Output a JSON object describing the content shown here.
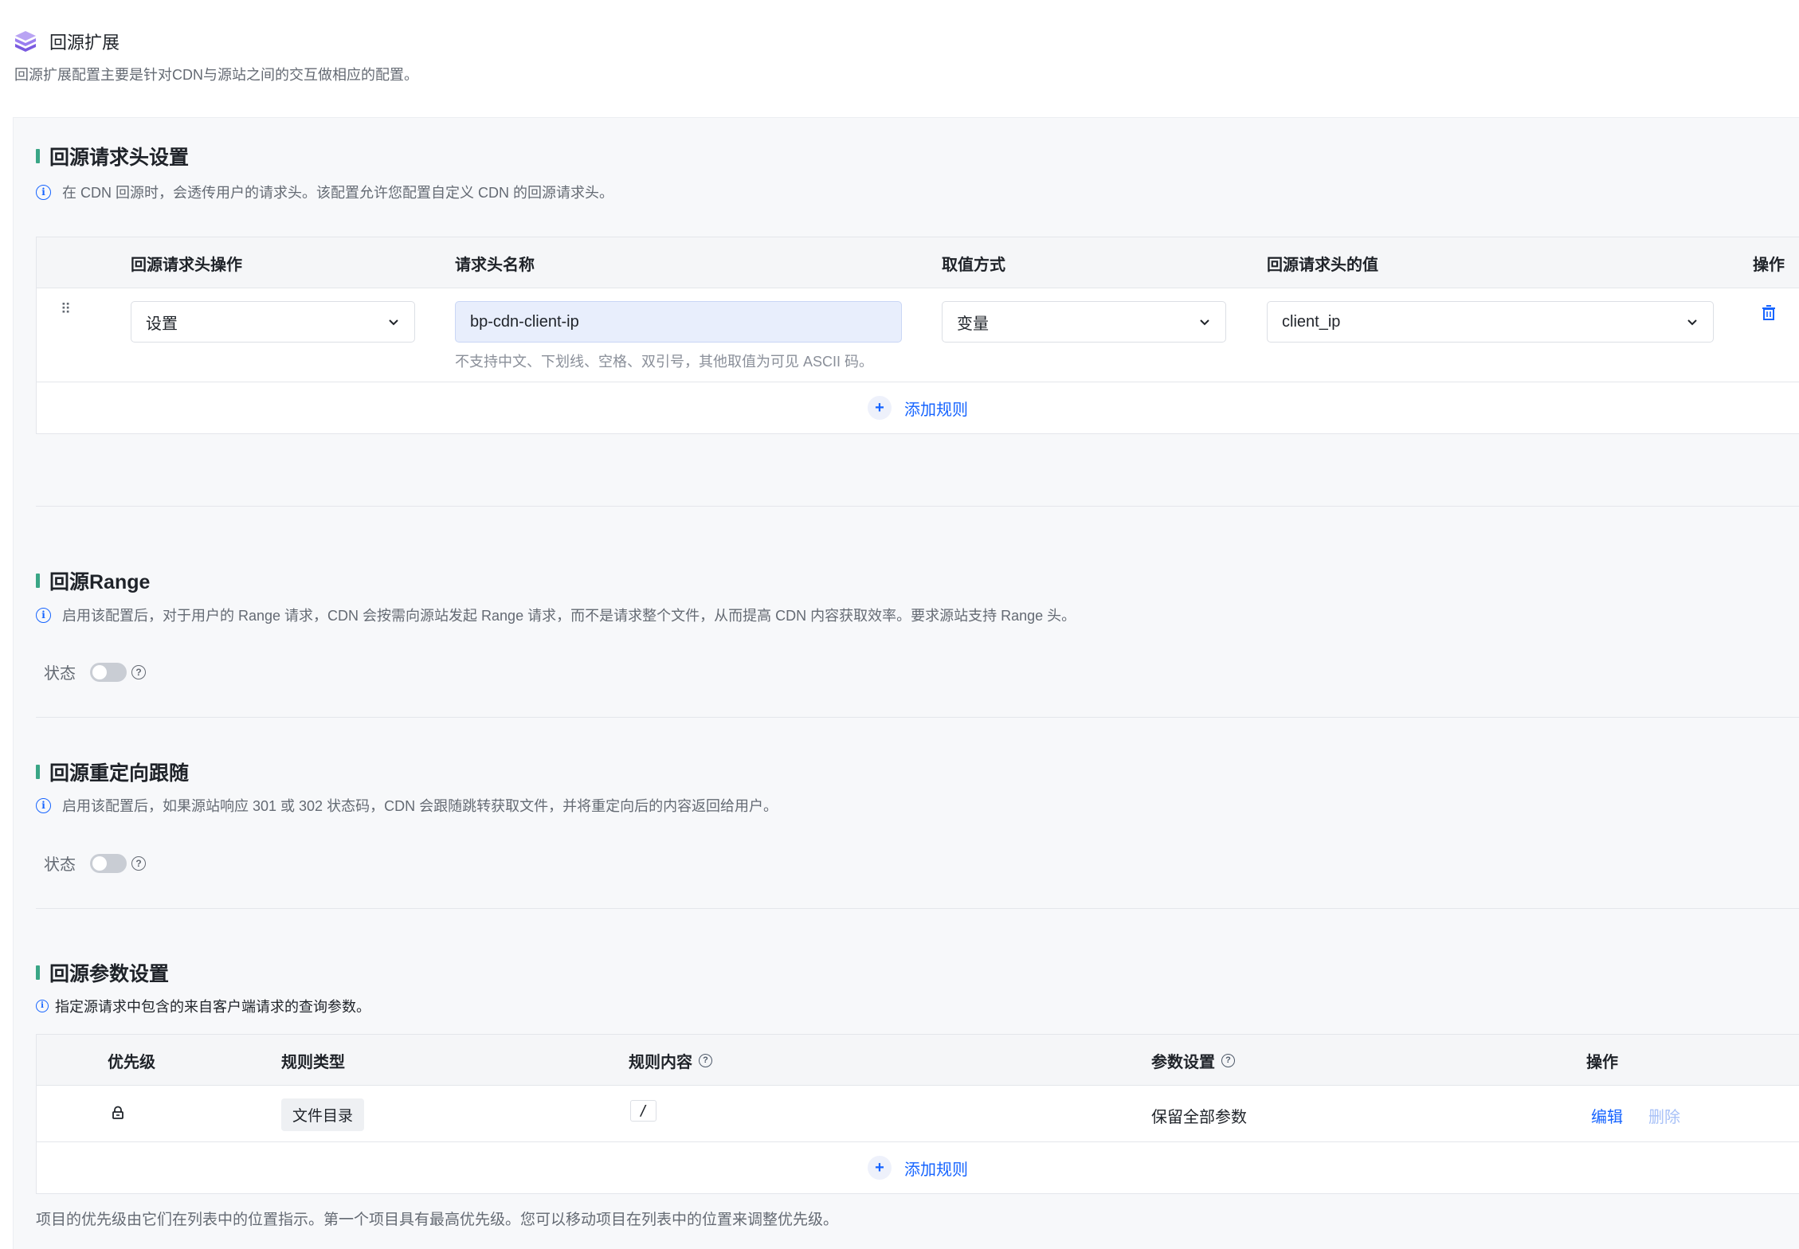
{
  "page": {
    "title": "回源扩展",
    "description": "回源扩展配置主要是针对CDN与源站之间的交互做相应的配置。"
  },
  "colors": {
    "accent": "#1664ff",
    "section_bar": "#3aa686",
    "logo": "#8d6be8"
  },
  "headers_section": {
    "title": "回源请求头设置",
    "info": "在 CDN 回源时，会透传用户的请求头。该配置允许您配置自定义 CDN 的回源请求头。",
    "columns": [
      "回源请求头操作",
      "请求头名称",
      "取值方式",
      "回源请求头的值",
      "操作"
    ],
    "rows": [
      {
        "operation": "设置",
        "name": "bp-cdn-client-ip",
        "name_hint": "不支持中文、下划线、空格、双引号，其他取值为可见 ASCII 码。",
        "value_type": "变量",
        "value": "client_ip"
      }
    ],
    "add_label": "添加规则"
  },
  "range_section": {
    "title": "回源Range",
    "info": "启用该配置后，对于用户的 Range 请求，CDN 会按需向源站发起 Range 请求，而不是请求整个文件，从而提高 CDN 内容获取效率。要求源站支持 Range 头。",
    "status_label": "状态",
    "enabled": false
  },
  "redirect_section": {
    "title": "回源重定向跟随",
    "info": "启用该配置后，如果源站响应 301 或 302 状态码，CDN 会跟随跳转获取文件，并将重定向后的内容返回给用户。",
    "status_label": "状态",
    "enabled": false
  },
  "params_section": {
    "title": "回源参数设置",
    "info": "指定源请求中包含的来自客户端请求的查询参数。",
    "columns": [
      "优先级",
      "规则类型",
      "规则内容",
      "参数设置",
      "操作"
    ],
    "rows": [
      {
        "rule_type": "文件目录",
        "rule_content": "/",
        "param_setting": "保留全部参数",
        "edit_label": "编辑",
        "delete_label": "删除"
      }
    ],
    "add_label": "添加规则",
    "footnote": "项目的优先级由它们在列表中的位置指示。第一个项目具有最高优先级。您可以移动项目在列表中的位置来调整优先级。"
  }
}
